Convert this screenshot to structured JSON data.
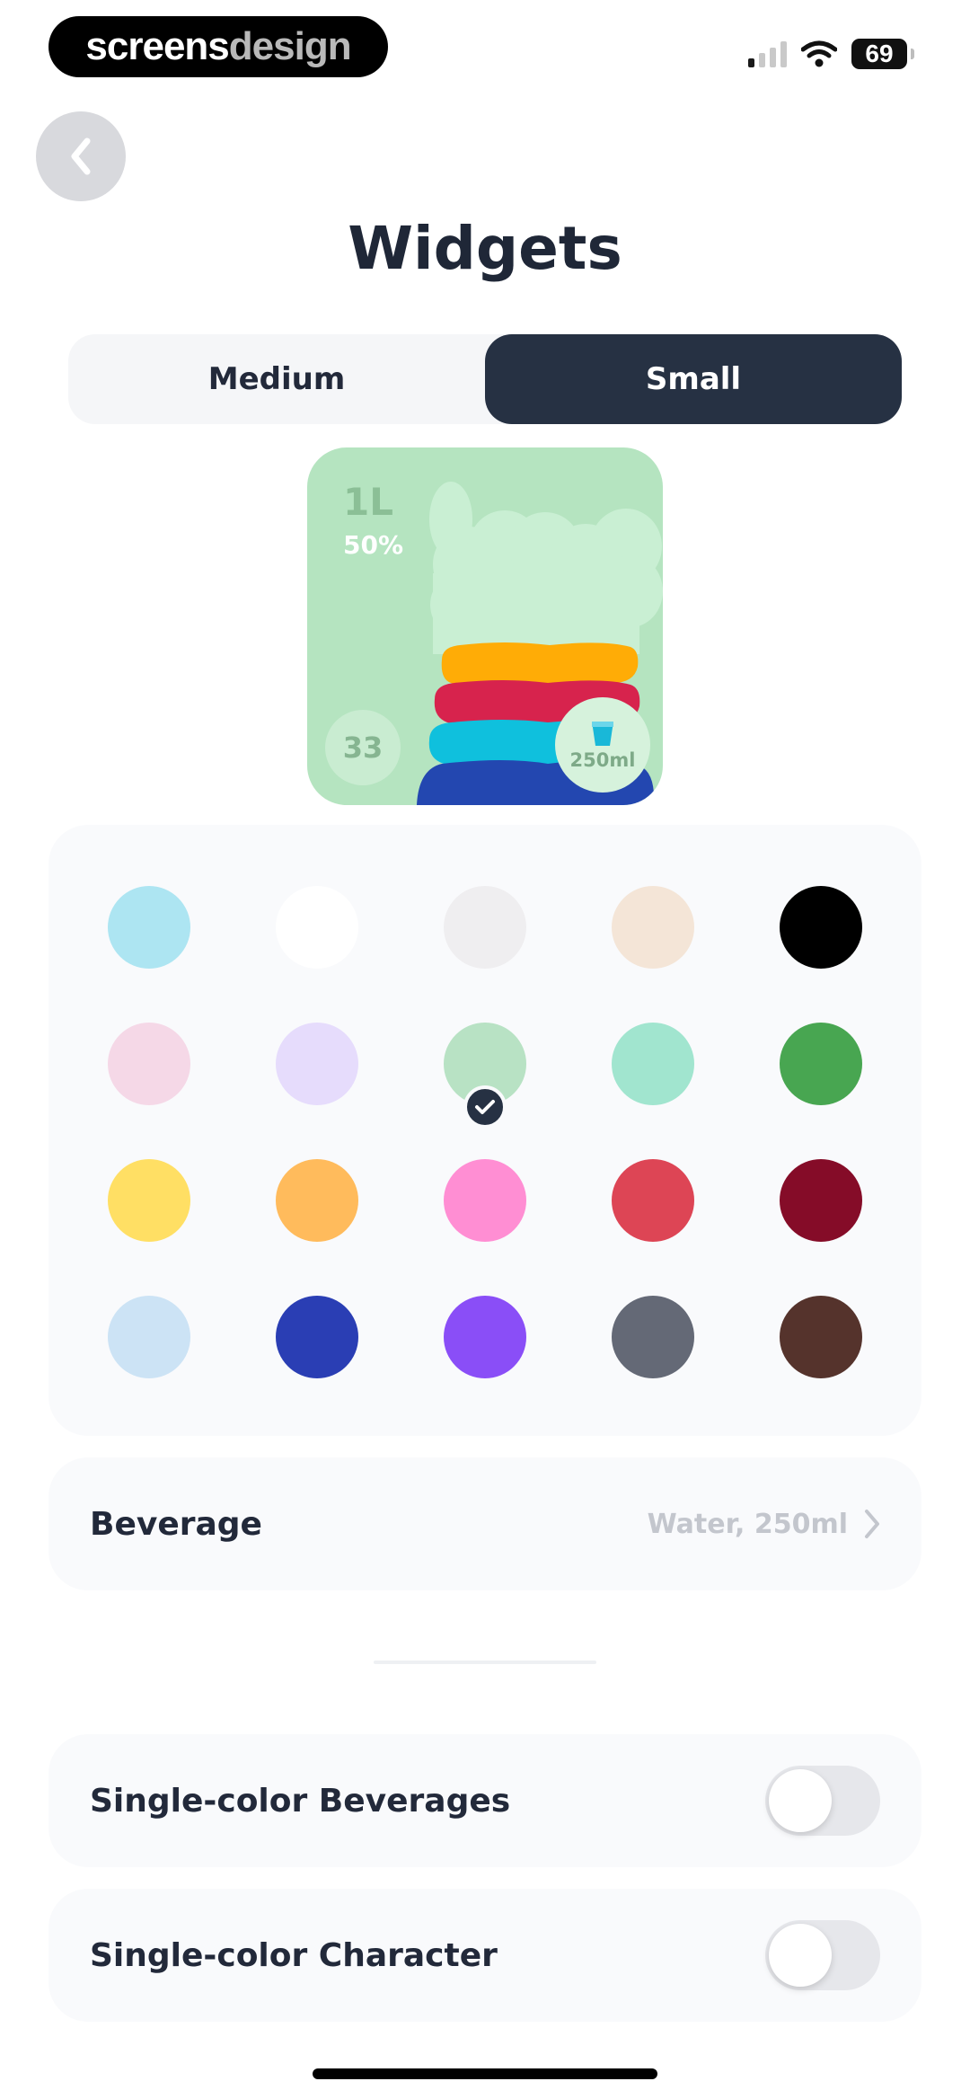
{
  "status_bar": {
    "brand_part1": "screens",
    "brand_part2": "design",
    "battery": "69"
  },
  "header": {
    "back_icon": "chevron-left-icon",
    "title": "Widgets"
  },
  "size_tabs": [
    {
      "label": "Medium",
      "selected": false
    },
    {
      "label": "Small",
      "selected": true
    }
  ],
  "widget_preview": {
    "amount": "1L",
    "percent": "50%",
    "count": "33",
    "drink": "250ml",
    "background_color": "#b5e4c0"
  },
  "palette": {
    "selected_color": "#b8e2c4",
    "colors": [
      "#ade5f2",
      "#ffffff",
      "#efeef0",
      "#f4e5d7",
      "#000000",
      "#f5d8e7",
      "#e6dcfc",
      "#b8e2c4",
      "#a1e5cf",
      "#48a651",
      "#ffdf64",
      "#ffbb5c",
      "#ff8ed3",
      "#dd4555",
      "#850c28",
      "#cce3f5",
      "#2a3eb4",
      "#8a4ef7",
      "#646976",
      "#55332c"
    ]
  },
  "beverage_row": {
    "label": "Beverage",
    "value": "Water, 250ml",
    "chevron_icon": "chevron-right-icon"
  },
  "toggle_rows": [
    {
      "label": "Single-color Beverages",
      "on": false
    },
    {
      "label": "Single-color Character",
      "on": false
    }
  ],
  "colors": {
    "accent_dark": "#263143",
    "card_background": "#f9fafc"
  }
}
